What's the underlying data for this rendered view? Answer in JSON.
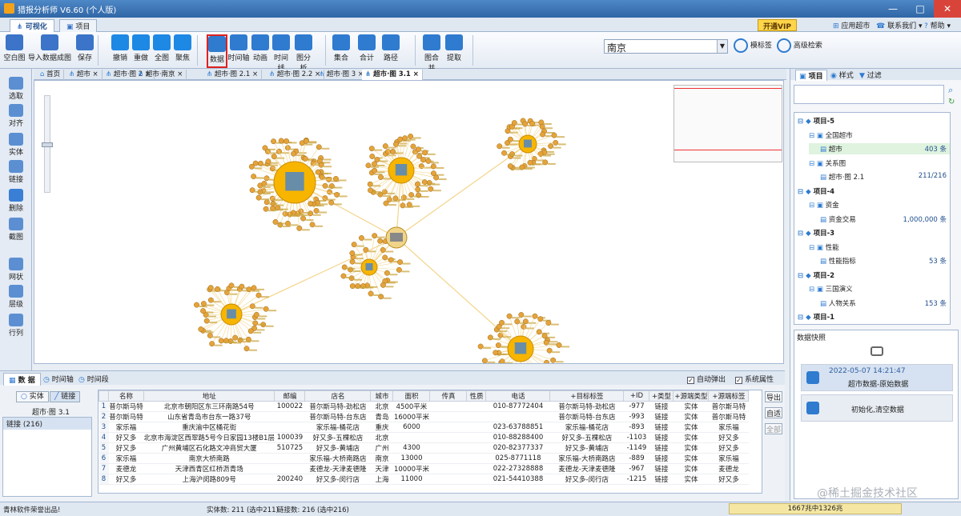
{
  "window": {
    "title": "猎报分析师 V6.60 (个人版)",
    "min": "—",
    "max": "□",
    "close": "✕"
  },
  "ribbon_tabs": [
    "可视化",
    "项目"
  ],
  "top_right": {
    "vip": "开通VIP",
    "apps": "应用超市",
    "contact": "联系我们 ▾",
    "help": "帮助 ▾"
  },
  "toolbar": [
    {
      "label": "空白图",
      "icon": "blank-page-icon",
      "color": "#3b74c8"
    },
    {
      "label": "导入数据成图",
      "icon": "import-data-icon",
      "color": "#3b74c8"
    },
    {
      "label": "保存",
      "icon": "save-icon",
      "color": "#3b74c8"
    },
    {
      "label": "撤销",
      "icon": "undo-icon",
      "color": "#1e88e5"
    },
    {
      "label": "重做",
      "icon": "redo-icon",
      "color": "#1e88e5"
    },
    {
      "label": "全图",
      "icon": "fit-all-icon",
      "color": "#1e88e5"
    },
    {
      "label": "聚焦",
      "icon": "focus-icon",
      "color": "#1e88e5"
    },
    {
      "label": "数据",
      "icon": "data-grid-icon",
      "color": "#2f7bd0"
    },
    {
      "label": "时间轴",
      "icon": "timeline-icon",
      "color": "#2f7bd0"
    },
    {
      "label": "动画",
      "icon": "animation-icon",
      "color": "#2f7bd0"
    },
    {
      "label": "时间线",
      "icon": "time-line-icon",
      "color": "#2f7bd0"
    },
    {
      "label": "图分析",
      "icon": "graph-analysis-icon",
      "color": "#2f7bd0"
    },
    {
      "label": "集合",
      "icon": "set-icon",
      "color": "#2f7bd0"
    },
    {
      "label": "合计",
      "icon": "sum-icon",
      "color": "#2f7bd0"
    },
    {
      "label": "路径",
      "icon": "path-icon",
      "color": "#2f7bd0"
    },
    {
      "label": "图合并",
      "icon": "graph-merge-icon",
      "color": "#2f7bd0"
    },
    {
      "label": "提取",
      "icon": "extract-icon",
      "color": "#2f7bd0"
    }
  ],
  "search": {
    "value": "南京",
    "fuzzy": "模标签",
    "advanced": "高级检索"
  },
  "left_tools": [
    "选取",
    "对齐",
    "实体",
    "链接",
    "删除",
    "截图",
    "网状",
    "层级",
    "行列"
  ],
  "doc_tabs": [
    "首页",
    "超市",
    "超市·图 2",
    "超市·南京",
    "超市·图 2.1",
    "超市·图 2.2",
    "超市·图 3",
    "超市·图 3.1"
  ],
  "bottom": {
    "tabs": [
      "数 据",
      "时间轴",
      "时间段"
    ],
    "auto_popup": "自动弹出",
    "system_props": "系统属性",
    "toggle_entity": "实体",
    "toggle_link": "链接",
    "graph_name": "超市·图 3.1",
    "list_item": "链接 (216)",
    "side_buttons": [
      "导出",
      "自适",
      "全部"
    ],
    "columns": [
      "名称",
      "地址",
      "邮编",
      "店名",
      "城市",
      "面积",
      "传真",
      "性质",
      "电话",
      "+目标标签",
      "+ID",
      "+类型",
      "+源端类型",
      "+源端标签"
    ],
    "rows": [
      [
        "普尔斯马特",
        "北京市朝阳区东三环南路54号",
        "100022",
        "普尔斯马特-劲松店",
        "北京",
        "4500平米",
        "",
        "",
        "010-87772404",
        "普尔斯马特-劲松店",
        "-977",
        "链接",
        "实体",
        "普尔斯马特"
      ],
      [
        "普尔斯马特",
        "山东省青岛市台东一路37号",
        "",
        "普尔斯马特-台东店",
        "青岛",
        "16000平米",
        "",
        "",
        "",
        "普尔斯马特-台东店",
        "-993",
        "链接",
        "实体",
        "普尔斯马特"
      ],
      [
        "家乐福",
        "重庆渝中区桶花街",
        "",
        "家乐福-桶花店",
        "重庆",
        "6000",
        "",
        "",
        "023-63788851",
        "家乐福-桶花店",
        "-893",
        "链接",
        "实体",
        "家乐福"
      ],
      [
        "好又多",
        "北京市海淀区西翠路5号今日家园13楼B1层",
        "100039",
        "好又多-五棵松店",
        "北京",
        "",
        "",
        "",
        "010-88288400",
        "好又多-五棵松店",
        "-1103",
        "链接",
        "实体",
        "好又多"
      ],
      [
        "好又多",
        "广州黄埔区石化路文冲商贸大厦",
        "510725",
        "好又多-黄埔店",
        "广州",
        "4300",
        "",
        "",
        "020-82377337",
        "好又多-黄埔店",
        "-1149",
        "链接",
        "实体",
        "好又多"
      ],
      [
        "家乐福",
        "南京大桥南路",
        "",
        "家乐福-大桥南路店",
        "南京",
        "13000",
        "",
        "",
        "025-8771118",
        "家乐福-大桥南路店",
        "-889",
        "链接",
        "实体",
        "家乐福"
      ],
      [
        "麦德龙",
        "天津西青区红桥沥青场",
        "",
        "麦德龙-天津麦德隆",
        "天津",
        "10000平米",
        "",
        "",
        "022-27328888",
        "麦德龙-天津麦德隆",
        "-967",
        "链接",
        "实体",
        "麦德龙"
      ],
      [
        "好又多",
        "上海沪闵路809号",
        "200240",
        "好又多-闵行店",
        "上海",
        "11000",
        "",
        "",
        "021-54410388",
        "好又多-闵行店",
        "-1215",
        "链接",
        "实体",
        "好又多"
      ]
    ]
  },
  "right_panel": {
    "tabs": [
      "项目",
      "样式",
      "过滤"
    ],
    "tree": [
      {
        "label": "项目-5",
        "level": 0
      },
      {
        "label": "全国超市",
        "level": 1
      },
      {
        "label": "超市",
        "level": 2,
        "count": "403 条",
        "selected": true
      },
      {
        "label": "关系图",
        "level": 1
      },
      {
        "label": "超市·图 2.1",
        "level": 2,
        "count": "211/216"
      },
      {
        "label": "项目-4",
        "level": 0
      },
      {
        "label": "资金",
        "level": 1
      },
      {
        "label": "资金交易",
        "level": 2,
        "count": "1,000,000 条"
      },
      {
        "label": "项目-3",
        "level": 0
      },
      {
        "label": "性能",
        "level": 1
      },
      {
        "label": "性能指标",
        "level": 2,
        "count": "53 条"
      },
      {
        "label": "项目-2",
        "level": 0
      },
      {
        "label": "三国演义",
        "level": 1
      },
      {
        "label": "人物关系",
        "level": 2,
        "count": "153 条"
      },
      {
        "label": "项目-1",
        "level": 0
      }
    ],
    "snapshot_title": "数据快照",
    "snapshots": [
      {
        "time": "2022-05-07 14:21:47",
        "label": "超市数据-原始数据"
      },
      {
        "time": "",
        "label": "初始化,清空数据"
      }
    ]
  },
  "status": {
    "left": "青林软件荣誉出品!",
    "entities": "实体数: 211 (选中211)",
    "links": "链接数: 216 (选中216)",
    "memory": "1667兆中1326兆",
    "watermark": "@稀土掘金技术社区"
  },
  "graph": {
    "hub_color": "#f7b500",
    "node_color": "#e5a33a",
    "edge_color": "#f3d58a",
    "label_color": "#c9a23a"
  }
}
